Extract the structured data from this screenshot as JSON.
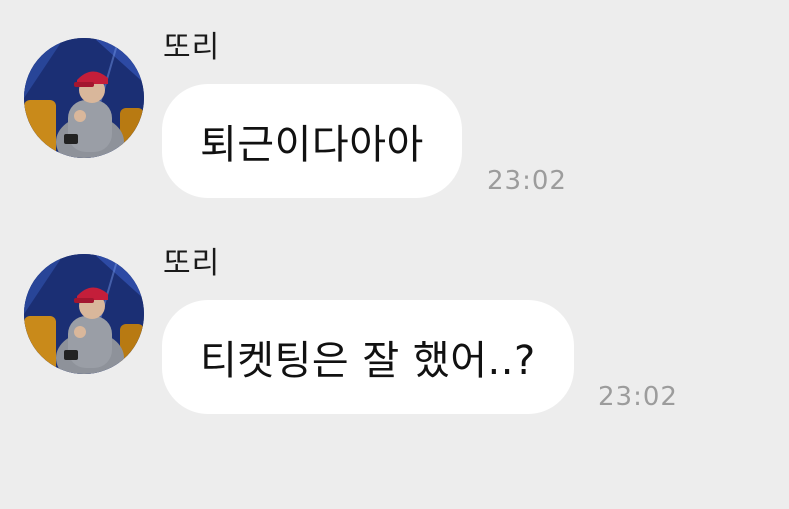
{
  "colors": {
    "background": "#ededed",
    "bubble": "#ffffff",
    "timestamp": "#9c9c9c",
    "cap": "#c41e3a",
    "avatar_stage": "#1b2f74"
  },
  "messages": [
    {
      "sender": "또리",
      "avatar_icon": "profile-avatar-icon",
      "text": "퇴근이다아아",
      "time": "23:02"
    },
    {
      "sender": "또리",
      "avatar_icon": "profile-avatar-icon",
      "text": "티켓팅은 잘 했어..?",
      "time": "23:02"
    }
  ]
}
